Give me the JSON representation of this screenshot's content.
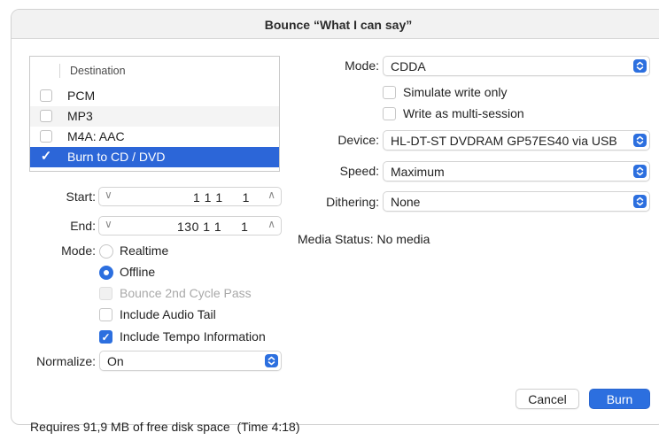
{
  "window": {
    "title": "Bounce “What I can say”"
  },
  "destination": {
    "header": "Destination",
    "items": [
      {
        "label": "PCM",
        "checked": false
      },
      {
        "label": "MP3",
        "checked": false
      },
      {
        "label": "M4A: AAC",
        "checked": false
      },
      {
        "label": "Burn to CD / DVD",
        "checked": true
      }
    ]
  },
  "range": {
    "start_label": "Start:",
    "start_value": "1 1 1     1",
    "end_label": "End:",
    "end_value": "130 1 1     1"
  },
  "bounce_mode": {
    "label": "Mode:",
    "realtime": "Realtime",
    "offline": "Offline",
    "selected": "Offline"
  },
  "options": {
    "bounce_2nd_cycle": "Bounce 2nd Cycle Pass",
    "include_audio_tail": "Include Audio Tail",
    "include_tempo": "Include Tempo Information"
  },
  "normalize": {
    "label": "Normalize:",
    "value": "On"
  },
  "cd": {
    "mode_label": "Mode:",
    "mode_value": "CDDA",
    "simulate": "Simulate write only",
    "multisession": "Write as multi-session",
    "device_label": "Device:",
    "device_value": "HL-DT-ST DVDRAM GP57ES40 via USB",
    "speed_label": "Speed:",
    "speed_value": "Maximum",
    "dithering_label": "Dithering:",
    "dithering_value": "None",
    "media_status_label": "Media Status:",
    "media_status_value": "No media"
  },
  "footer": {
    "requirement": "Requires 91,9 MB of free disk space  (Time 4:18)",
    "cancel": "Cancel",
    "burn": "Burn"
  },
  "colors": {
    "accent": "#2c6fdf",
    "selection": "#2c66d8"
  }
}
